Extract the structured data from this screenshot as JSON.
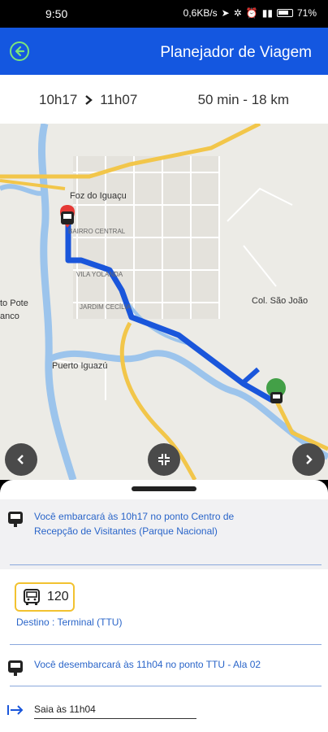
{
  "status_bar": {
    "time": "9:50",
    "network": "0,6KB/s",
    "battery": "71%"
  },
  "header": {
    "title": "Planejador de Viagem"
  },
  "summary": {
    "depart": "10h17",
    "arrive": "11h07",
    "duration": "50 min - 18 km"
  },
  "map": {
    "labels": {
      "foz": "Foz do Iguaçu",
      "bairro_central": "BAIRRO CENTRAL",
      "vila_yolanda": "VILA YOLANDA",
      "jardim_cecilia": "JARDIM CECÍLIA",
      "col_sao_joao": "Col. São João",
      "puerto_iguazu": "Puerto Iguazú",
      "porto_pote": "to Pote",
      "ranco": "anco"
    },
    "colors": {
      "route": "#1a56db",
      "start_pin": "#e53935",
      "end_pin": "#43a047"
    }
  },
  "steps": {
    "board": "Você embarcará às 10h17 no ponto Centro de Recepção de Visitantes (Parque Nacional)",
    "route_number": "120",
    "destination": "Destino : Terminal (TTU)",
    "alight": "Você desembarcará às 11h04 no ponto TTU - Ala 02",
    "leave": "Saia às 11h04"
  }
}
